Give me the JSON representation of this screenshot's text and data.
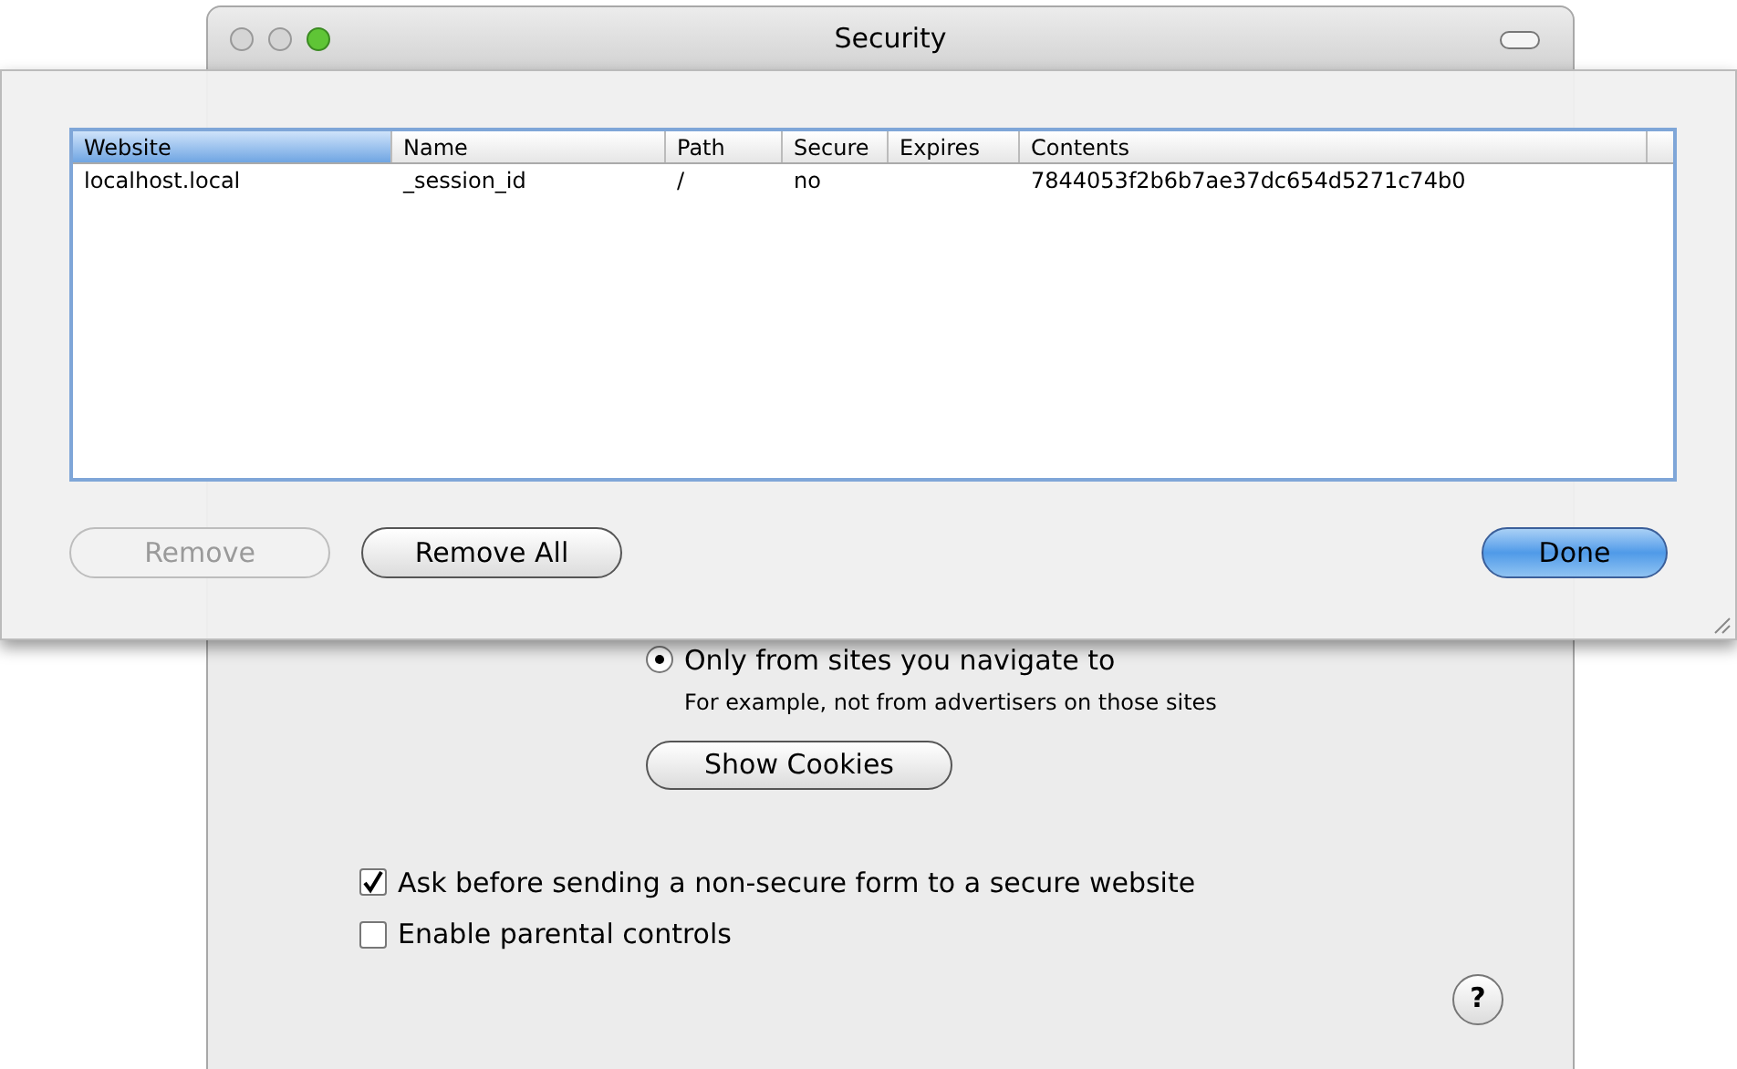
{
  "window": {
    "title": "Security"
  },
  "sheet": {
    "table": {
      "columns": [
        {
          "label": "Website",
          "selected": true
        },
        {
          "label": "Name",
          "selected": false
        },
        {
          "label": "Path",
          "selected": false
        },
        {
          "label": "Secure",
          "selected": false
        },
        {
          "label": "Expires",
          "selected": false
        },
        {
          "label": "Contents",
          "selected": false
        }
      ],
      "rows": [
        [
          "localhost.local",
          "_session_id",
          "/",
          "no",
          "",
          "7844053f2b6b7ae37dc654d5271c74b0"
        ]
      ]
    },
    "buttons": [
      {
        "label": "Remove",
        "disabled": true,
        "kind": "plain"
      },
      {
        "label": "Remove All",
        "disabled": false,
        "kind": "plain"
      },
      {
        "label": "Done",
        "disabled": false,
        "kind": "default"
      }
    ]
  },
  "cookie_options": [
    {
      "label": "Only from sites you navigate to",
      "note": "For example, not from advertisers on those sites",
      "selected": true
    }
  ],
  "show_cookies_button": "Show Cookies",
  "checkboxes": [
    {
      "label": "Ask before sending a non-secure form to a secure website",
      "checked": true
    },
    {
      "label": "Enable parental controls",
      "checked": false
    }
  ],
  "help_button": "?"
}
